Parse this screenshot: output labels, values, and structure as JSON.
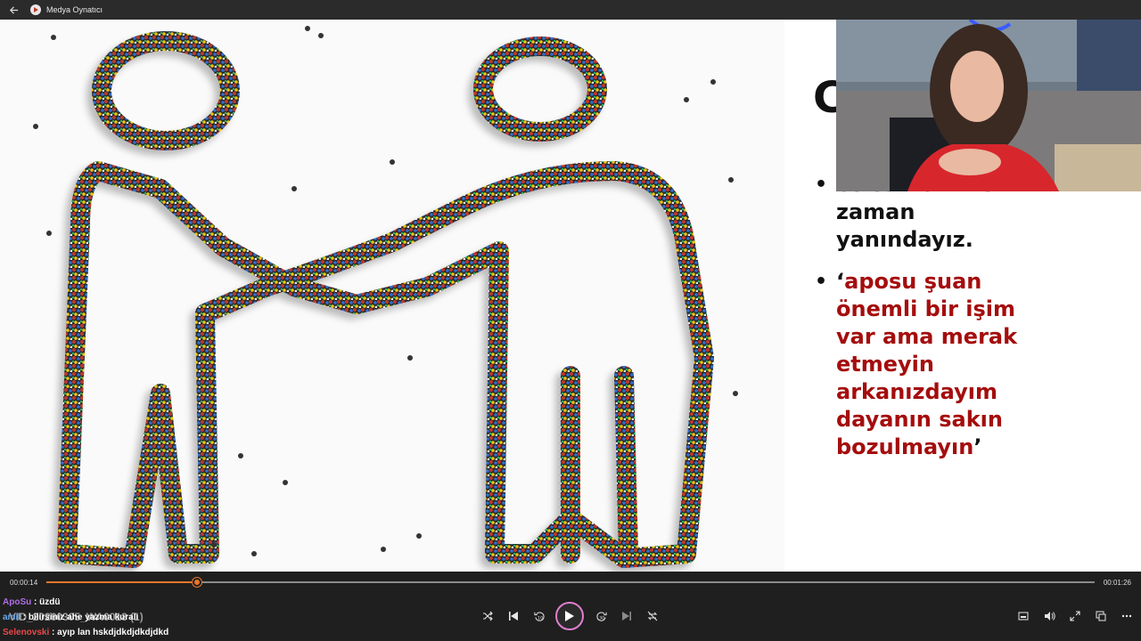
{
  "window": {
    "title": "Medya Oynatıcı"
  },
  "slide": {
    "partial_title": "C",
    "bullets": [
      {
        "text": "celsamom her zaman yanındayız.",
        "color": "#111111"
      },
      {
        "text": "aposu şuan önemli bir işim var ama merak etmeyin arkanızdayım dayanın sakın bozulmayın",
        "color": "#a50d0d"
      }
    ],
    "quote_open": "‘",
    "quote_close": "’"
  },
  "player": {
    "current_time": "00:00:14",
    "total_time": "00:01:26",
    "progress": 0.144,
    "accent": "#e8762b",
    "play_ring": "#e07fd0",
    "icons": {
      "back": "back-arrow-icon",
      "shuffle": "shuffle-icon",
      "previous": "skip-previous-icon",
      "rewind": "rewind-10-icon",
      "play": "play-icon",
      "forward": "forward-30-icon",
      "next": "skip-next-icon",
      "repeat": "repeat-off-icon",
      "miniplayer": "miniplayer-icon",
      "volume": "volume-icon",
      "fullscreen": "fullscreen-icon",
      "cast": "cast-icon",
      "more": "more-icon"
    }
  },
  "file_name_overlap": "VID_20260305_WA0018 (1)",
  "chat": [
    {
      "user": "ApoSu",
      "user_color": "#b06ee8",
      "message": "üzdü"
    },
    {
      "user": "amil",
      "user_color": "#6aa8e8",
      "message": "bilirsiniz ahe yazma kuralı"
    },
    {
      "user": "Selenovski",
      "user_color": "#e84a4a",
      "message": "ayıp lan hskdjdkdjdkdjdkd"
    }
  ]
}
